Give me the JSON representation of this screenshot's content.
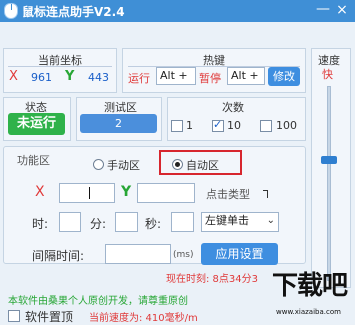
{
  "window": {
    "title": "鼠标连点助手V2.4",
    "close_glyph": "×",
    "minimize_glyph": "—"
  },
  "coords": {
    "label": "当前坐标",
    "x_label": "X",
    "x_value": "961",
    "y_label": "Y",
    "y_value": "443"
  },
  "hotkey": {
    "label": "热键",
    "run_label": "运行",
    "run_value": "Alt +",
    "pause_label": "暂停",
    "pause_value": "Alt +",
    "modify_label": "修改"
  },
  "speed": {
    "label": "速度",
    "fast_label": "快"
  },
  "status": {
    "label": "状态",
    "value": "未运行"
  },
  "test": {
    "label": "测试区",
    "value": "2"
  },
  "count": {
    "label": "次数",
    "options": [
      "1",
      "10",
      "100"
    ],
    "selected": "10"
  },
  "function": {
    "label": "功能区",
    "manual_label": "手动区",
    "auto_label": "自动区",
    "selected": "自动区",
    "x_label": "X",
    "y_label": "Y",
    "click_type_label": "点击类型",
    "hour_label": "时:",
    "minute_label": "分:",
    "second_label": "秒:",
    "click_type_value": "左键单击",
    "interval_label": "间隔时间:",
    "interval_unit": "(ms)",
    "apply_label": "应用设置",
    "current_time_label": "现在时刻: 8点34分3"
  },
  "footer": {
    "notice": "本软件由桑果个人原创开发，请尊重原创",
    "topmost_label": "软件置顶",
    "current_speed_label": "当前速度为: 410毫秒/m"
  },
  "watermark": {
    "text": "下载吧",
    "url_text": "www.xiazaiba.com"
  },
  "colors": {
    "titlebar": "#3f8fd6",
    "status_bg": "#2fb24a",
    "test_bg": "#4b8fdc",
    "apply_bg": "#3e8ee0",
    "highlight_border": "#d7262e"
  }
}
